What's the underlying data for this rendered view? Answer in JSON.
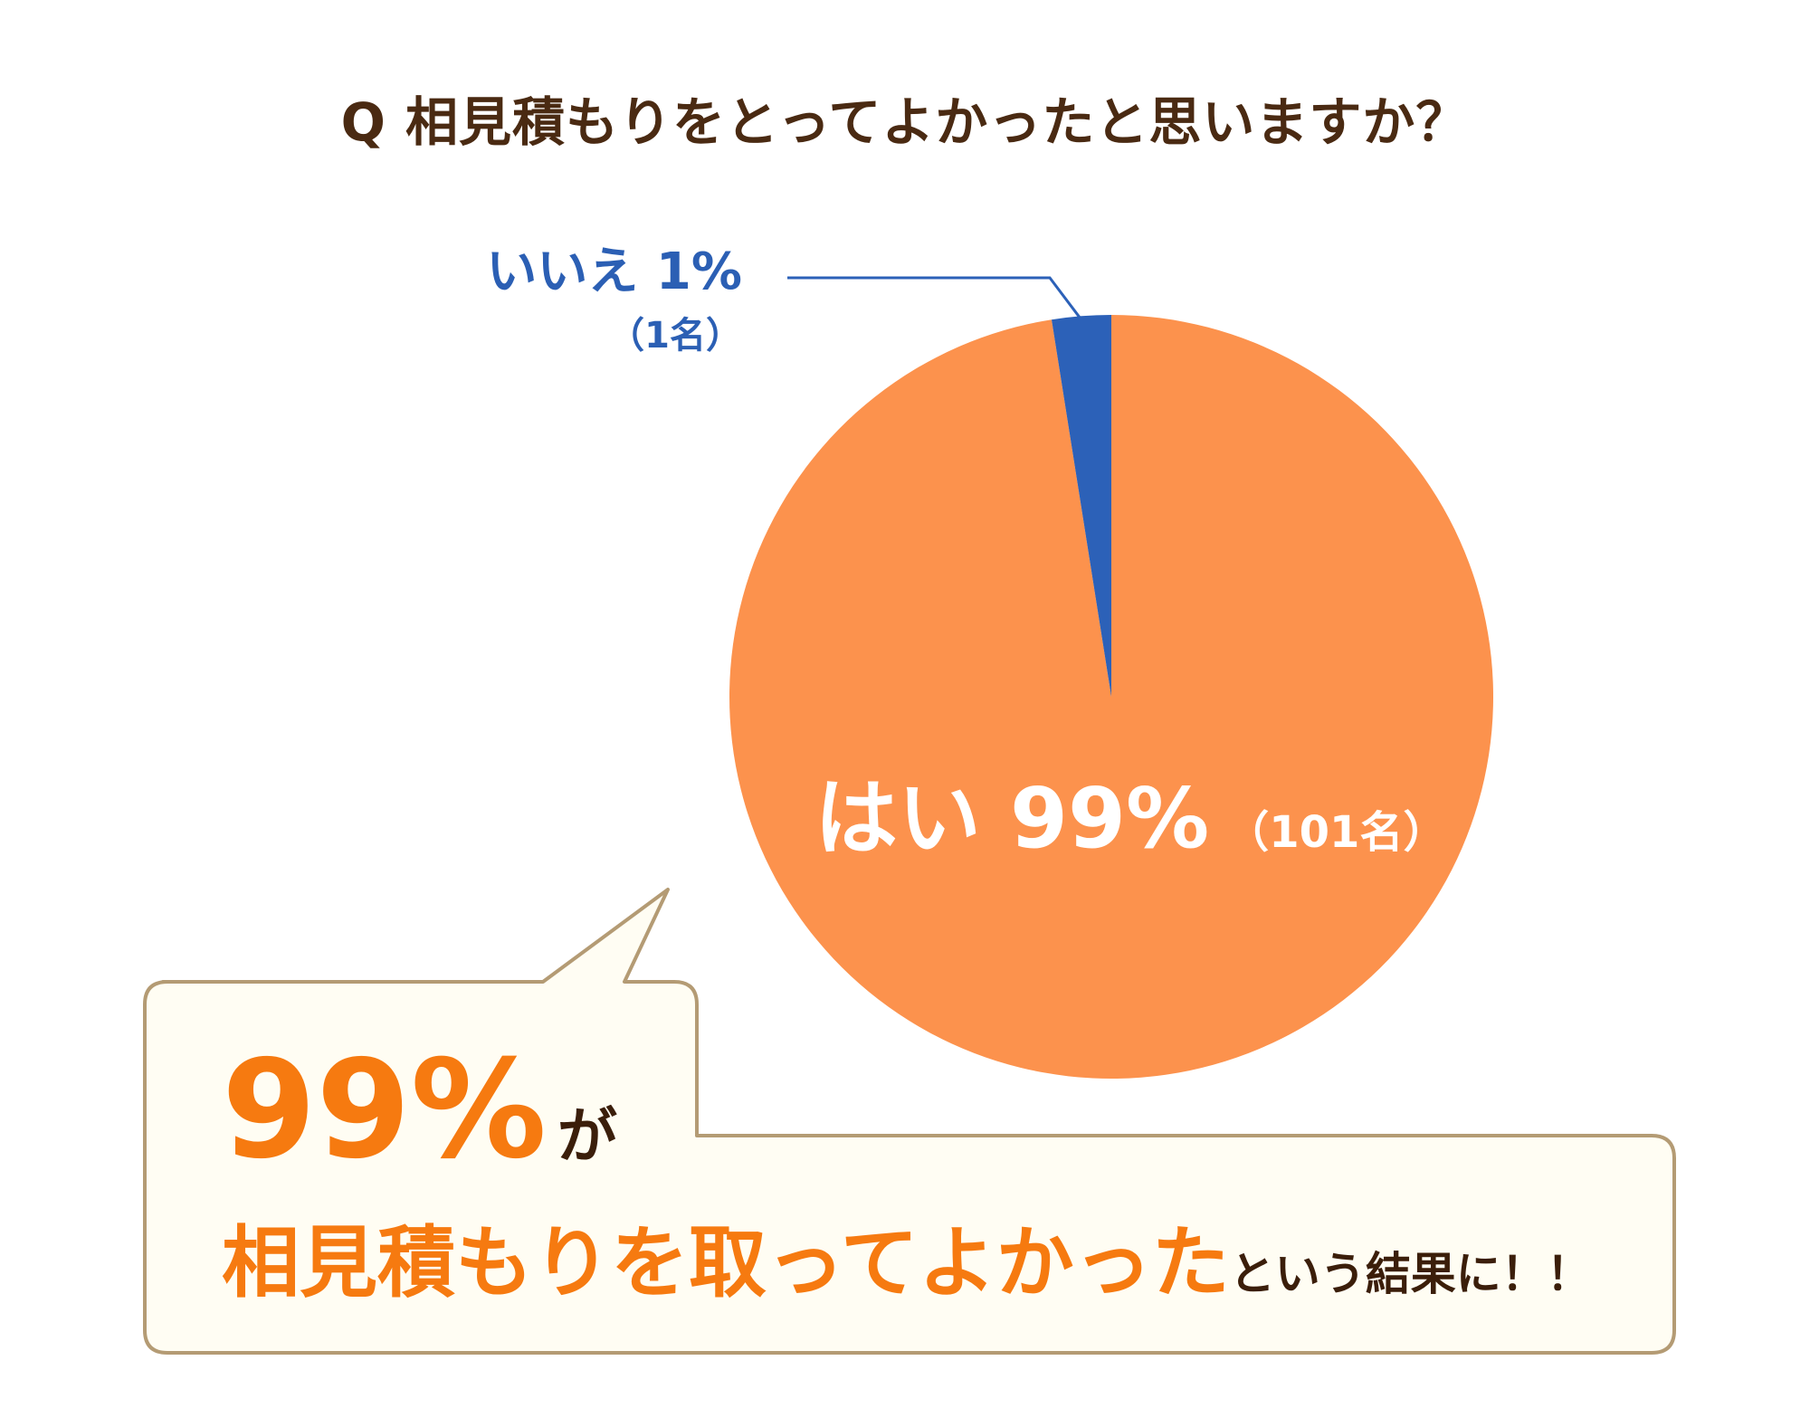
{
  "title": "Q 相見積もりをとってよかったと思いますか？",
  "colors": {
    "yes": "#fc924d",
    "no": "#2c61b8",
    "bubble_fill": "#fffdf3",
    "bubble_stroke": "#b49b74",
    "accent": "#f67a10",
    "text_dark": "#3b1e0a"
  },
  "chart_data": {
    "type": "pie",
    "categories": [
      "はい",
      "いいえ"
    ],
    "values": [
      99,
      1
    ],
    "counts": [
      101,
      1
    ],
    "labels": {
      "yes_main": "はい 99%",
      "yes_sub": "（101名）",
      "no_main": "いいえ 1%",
      "no_sub": "（1名）"
    }
  },
  "callout": {
    "percent": "99%",
    "ga": "が",
    "highlight": "相見積もりを取ってよかった",
    "suffix": "という結果に！！"
  }
}
